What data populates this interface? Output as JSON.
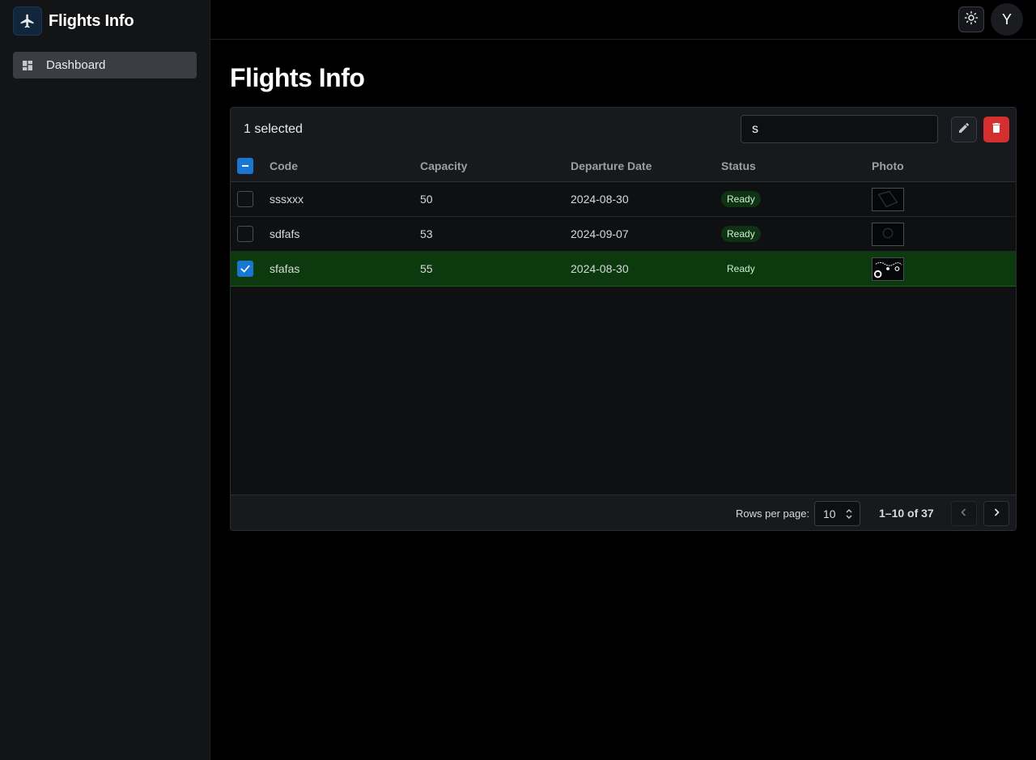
{
  "app": {
    "title": "Flights Info",
    "logo_icon": "airplane-icon"
  },
  "sidebar": {
    "items": [
      {
        "label": "Dashboard",
        "icon": "dashboard-icon",
        "active": true
      }
    ]
  },
  "topbar": {
    "theme_icon": "sun-icon",
    "avatar_initial": "Y"
  },
  "main": {
    "page_title": "Flights Info"
  },
  "grid": {
    "selected_text": "1 selected",
    "search_value": "s",
    "columns": [
      "Code",
      "Capacity",
      "Departure Date",
      "Status",
      "Photo"
    ],
    "rows": [
      {
        "code": "sssxxx",
        "capacity": "50",
        "departure_date": "2024-08-30",
        "status": "Ready",
        "selected": false
      },
      {
        "code": "sdfafs",
        "capacity": "53",
        "departure_date": "2024-09-07",
        "status": "Ready",
        "selected": false
      },
      {
        "code": "sfafas",
        "capacity": "55",
        "departure_date": "2024-08-30",
        "status": "Ready",
        "selected": true
      }
    ],
    "footer": {
      "rows_per_page_label": "Rows per page:",
      "rows_per_page_value": "10",
      "range_text": "1–10 of 37"
    }
  },
  "colors": {
    "accent": "#1976d2",
    "danger": "#d32f2f",
    "selected_row": "#0c3a0e"
  }
}
